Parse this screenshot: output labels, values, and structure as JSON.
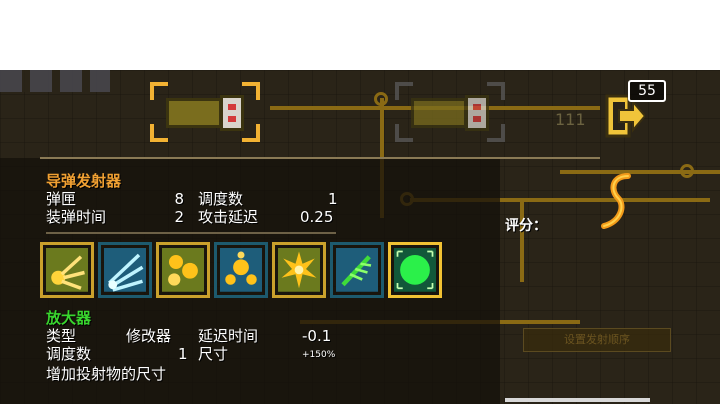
{
  "hud": {
    "ammo_badge": "55",
    "shield_count": "111",
    "score_label": "评分："
  },
  "weapon": {
    "name": "导弹发射器",
    "stats_left": [
      {
        "label": "弹匣",
        "value": "8"
      },
      {
        "label": "装弹时间",
        "value": "2"
      }
    ],
    "stats_right": [
      {
        "label": "调度数",
        "value": "1"
      },
      {
        "label": "攻击延迟",
        "value": "0.25"
      }
    ]
  },
  "chips": [
    {
      "icon": "spread-burst-icon",
      "frame": "gold"
    },
    {
      "icon": "ice-shards-icon",
      "frame": "blue"
    },
    {
      "icon": "triple-orbs-icon",
      "frame": "gold"
    },
    {
      "icon": "cluster-orbs-icon",
      "frame": "blue"
    },
    {
      "icon": "explosion-icon",
      "frame": "gold"
    },
    {
      "icon": "leaf-needle-icon",
      "frame": "blue"
    },
    {
      "icon": "enlarge-orb-icon",
      "frame": "active"
    }
  ],
  "modifier": {
    "name": "放大器",
    "type_label": "类型",
    "type_value": "修改器",
    "delay_label": "延迟时间",
    "delay_value": "-0.1",
    "dispatch_label": "调度数",
    "dispatch_value": "1",
    "size_label": "尺寸",
    "size_value": "+150%",
    "description": "增加投射物的尺寸"
  },
  "ghost_button": "设置发射顺序",
  "colors": {
    "accent_orange": "#f0a032",
    "accent_green": "#39d62e",
    "bracket_gold": "#f2b233"
  }
}
